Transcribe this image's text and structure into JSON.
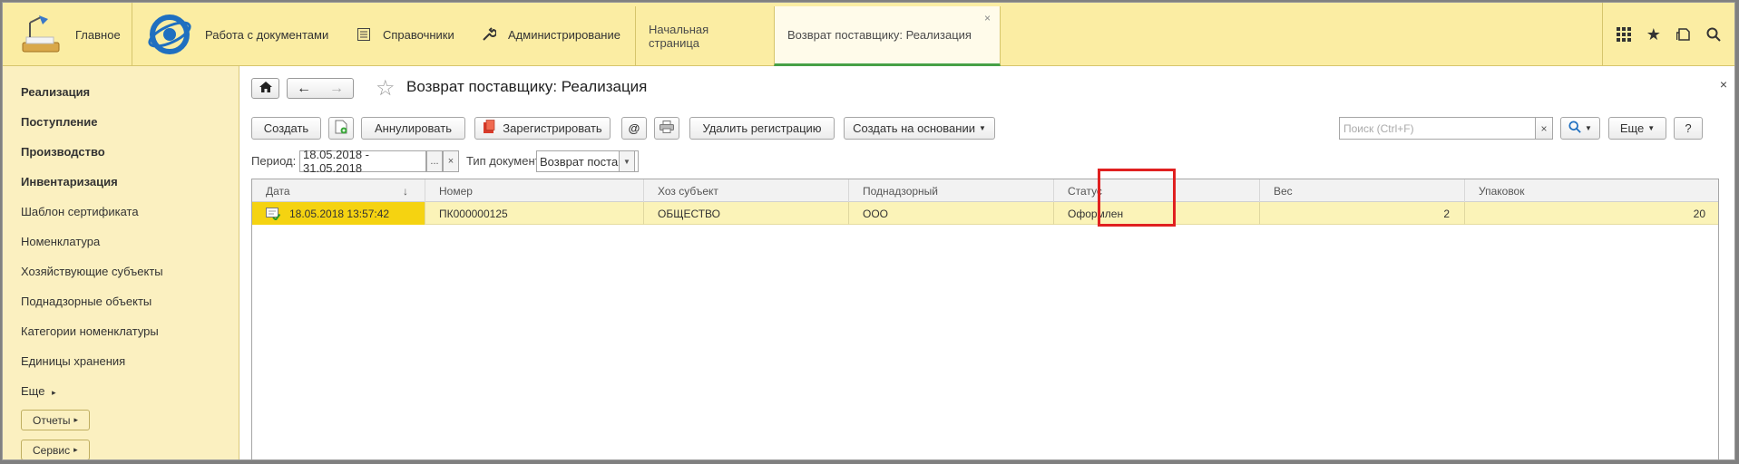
{
  "topbar": {
    "home_label": "Главное",
    "documents_label": "Работа с документами",
    "reference_label": "Справочники",
    "admin_label": "Администрирование",
    "tabs": [
      {
        "label": "Начальная страница"
      },
      {
        "label": "Возврат поставщику: Реализация",
        "close": "×"
      }
    ]
  },
  "sidebar": {
    "items": [
      {
        "label": "Реализация"
      },
      {
        "label": "Поступление"
      },
      {
        "label": "Производство"
      },
      {
        "label": "Инвентаризация"
      },
      {
        "label": "Шаблон сертификата"
      },
      {
        "label": "Номенклатура"
      },
      {
        "label": "Хозяйствующие субъекты"
      },
      {
        "label": "Поднадзорные объекты"
      },
      {
        "label": "Категории номенклатуры"
      },
      {
        "label": "Единицы хранения"
      },
      {
        "label": "Еще"
      }
    ],
    "reports_label": "Отчеты",
    "service_label": "Сервис"
  },
  "main": {
    "title": "Возврат поставщику: Реализация",
    "close": "×",
    "toolbar": {
      "create": "Создать",
      "cancel": "Аннулировать",
      "register": "Зарегистрировать",
      "at": "@",
      "delete_registration": "Удалить регистрацию",
      "create_based": "Создать на основании",
      "search_placeholder": "Поиск (Ctrl+F)",
      "search_clear": "×",
      "more": "Еще",
      "help": "?"
    },
    "filters": {
      "period_label": "Период:",
      "period_value": "18.05.2018 - 31.05.2018",
      "period_dots": "...",
      "period_clear": "×",
      "doc_type_label": "Тип документа:",
      "doc_type_value": "Возврат поставщ"
    },
    "table": {
      "columns": [
        "Дата",
        "Номер",
        "Хоз субъект",
        "Поднадзорный",
        "Статус",
        "Вес",
        "Упаковок"
      ],
      "sort_indicator": "↓",
      "rows": [
        {
          "date": "18.05.2018 13:57:42",
          "number": "ПК000000125",
          "entity": "ОБЩЕСТВО",
          "supervised": "ООО",
          "status": "Оформлен",
          "weight": "2",
          "packages": "20"
        }
      ]
    }
  },
  "colors": {
    "topbar_bg": "#fbeda3",
    "sidebar_bg": "#fbf0c0",
    "selected_cell": "#f5d311",
    "row_highlight": "#fbf3b8",
    "annotation_border": "#e02020"
  }
}
